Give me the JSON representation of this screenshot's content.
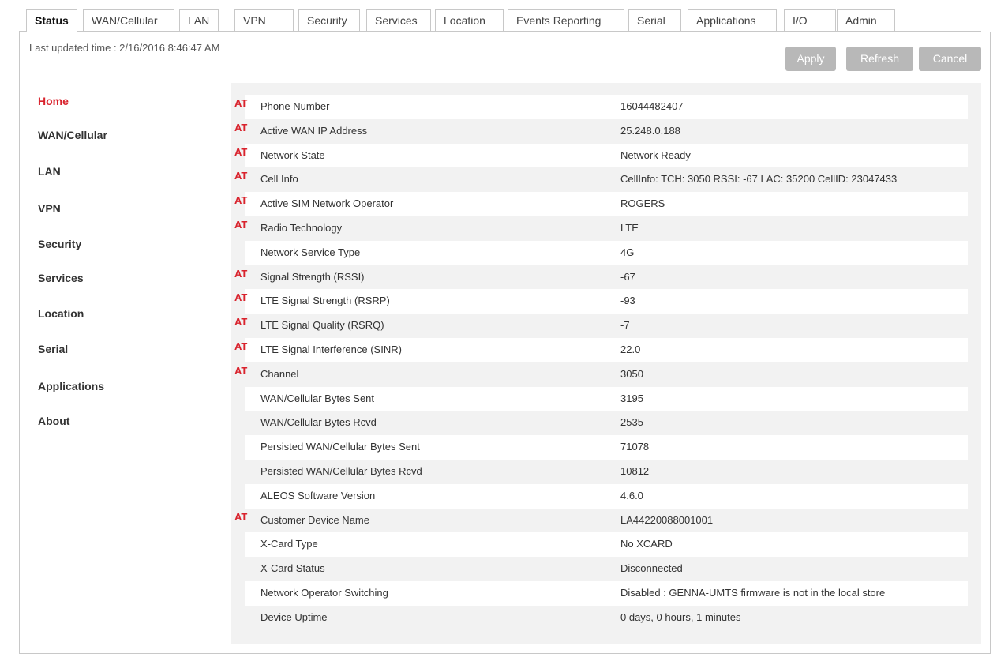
{
  "tabs": [
    {
      "label": "Status",
      "active": true
    },
    {
      "label": "WAN/Cellular"
    },
    {
      "label": "LAN"
    },
    {
      "label": "VPN"
    },
    {
      "label": "Security"
    },
    {
      "label": "Services"
    },
    {
      "label": "Location"
    },
    {
      "label": "Events Reporting"
    },
    {
      "label": "Serial"
    },
    {
      "label": "Applications"
    },
    {
      "label": "I/O"
    },
    {
      "label": "Admin"
    }
  ],
  "header": {
    "last_updated": "Last updated time : 2/16/2016 8:46:47 AM"
  },
  "toolbar": {
    "apply_label": "Apply",
    "refresh_label": "Refresh",
    "cancel_label": "Cancel"
  },
  "sidebar": {
    "items": [
      {
        "label": "Home",
        "active": true
      },
      {
        "label": "WAN/Cellular"
      },
      {
        "label": "LAN"
      },
      {
        "label": "VPN"
      },
      {
        "label": "Security"
      },
      {
        "label": "Services"
      },
      {
        "label": "Location"
      },
      {
        "label": "Serial"
      },
      {
        "label": "Applications"
      },
      {
        "label": "About"
      }
    ]
  },
  "at_marker": "AT",
  "status_rows": [
    {
      "label": "Phone Number",
      "value": "16044482407",
      "at": true
    },
    {
      "label": "Active WAN IP Address",
      "value": "25.248.0.188",
      "at": true
    },
    {
      "label": "Network State",
      "value": "Network Ready",
      "at": true
    },
    {
      "label": "Cell Info",
      "value": "CellInfo: TCH: 3050 RSSI: -67 LAC: 35200 CellID: 23047433",
      "at": true
    },
    {
      "label": "Active SIM Network Operator",
      "value": "ROGERS",
      "at": true
    },
    {
      "label": "Radio Technology",
      "value": "LTE",
      "at": true
    },
    {
      "label": "Network Service Type",
      "value": "4G",
      "at": false
    },
    {
      "label": "Signal Strength (RSSI)",
      "value": "-67",
      "at": true
    },
    {
      "label": "LTE Signal Strength (RSRP)",
      "value": "-93",
      "at": true
    },
    {
      "label": "LTE Signal Quality (RSRQ)",
      "value": "-7",
      "at": true
    },
    {
      "label": "LTE Signal Interference (SINR)",
      "value": "22.0",
      "at": true
    },
    {
      "label": "Channel",
      "value": "3050",
      "at": true
    },
    {
      "label": "WAN/Cellular Bytes Sent",
      "value": "3195",
      "at": false
    },
    {
      "label": "WAN/Cellular Bytes Rcvd",
      "value": "2535",
      "at": false
    },
    {
      "label": "Persisted WAN/Cellular Bytes Sent",
      "value": "71078",
      "at": false
    },
    {
      "label": "Persisted WAN/Cellular Bytes Rcvd",
      "value": "10812",
      "at": false
    },
    {
      "label": "ALEOS Software Version",
      "value": "4.6.0",
      "at": false
    },
    {
      "label": "Customer Device Name",
      "value": "LA44220088001001",
      "at": true
    },
    {
      "label": "X-Card Type",
      "value": "No XCARD",
      "at": false
    },
    {
      "label": "X-Card Status",
      "value": "Disconnected",
      "at": false
    },
    {
      "label": "Network Operator Switching",
      "value": "Disabled : GENNA-UMTS firmware is not in the local store",
      "at": false
    },
    {
      "label": "Device Uptime",
      "value": "0 days, 0 hours, 1 minutes",
      "at": false
    }
  ],
  "colors": {
    "accent_red": "#d9232d",
    "button_gray": "#b8b8b8",
    "panel_gray": "#f2f2f2"
  }
}
